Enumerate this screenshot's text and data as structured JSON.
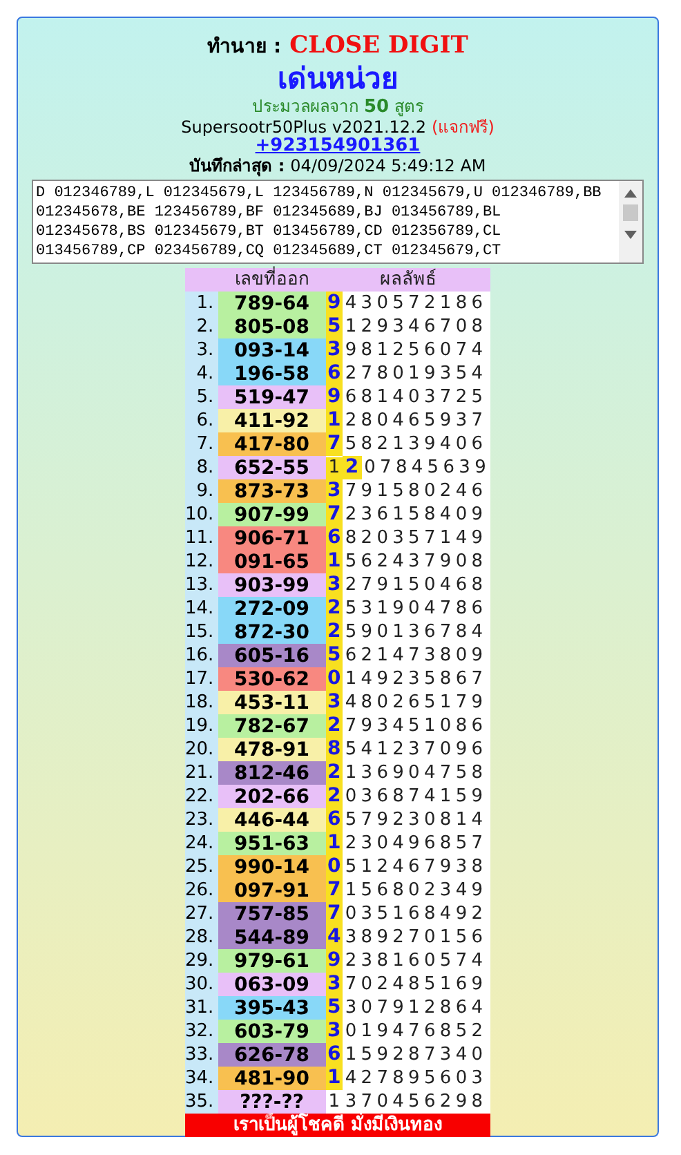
{
  "header": {
    "label": "ทำนาย :",
    "value": "CLOSE DIGIT"
  },
  "title": "เด่นหน่วย",
  "formula_note": "ประมวลผลจาก **50** สูตร",
  "version": {
    "name": "Supersootr50Plus v2021.12.2",
    "tag": "(แจกฟรี)"
  },
  "phone": "+923154901361",
  "last_saved": {
    "label": "บันทึกล่าสุด :",
    "value": "04/09/2024 5:49:12 AM"
  },
  "formula_text": "D 012346789,L 012345679,L 123456789,N 012345679,U 012346789,BB 012345678,BE 123456789,BF 012345689,BJ 013456789,BL 012345678,BS 012345679,BT 013456789,CD 012356789,CL 013456789,CP 023456789,CQ 012345689,CT 012345679,CT",
  "table": {
    "columns": [
      "เลขที่ออก",
      "ผลลัพธ์"
    ],
    "rows": [
      {
        "no": "1.",
        "code": "789-64",
        "color": "#b8f0a0",
        "strip": true,
        "result": [
          {
            "text": "9",
            "hit": true
          },
          {
            "text": "430572186",
            "hit": false
          }
        ]
      },
      {
        "no": "2.",
        "code": "805-08",
        "color": "#b8f0a0",
        "strip": true,
        "result": [
          {
            "text": "5",
            "hit": true
          },
          {
            "text": "129346708",
            "hit": false
          }
        ]
      },
      {
        "no": "3.",
        "code": "093-14",
        "color": "#88d8f8",
        "strip": true,
        "result": [
          {
            "text": "3",
            "hit": true
          },
          {
            "text": "981256074",
            "hit": false
          }
        ]
      },
      {
        "no": "4.",
        "code": "196-58",
        "color": "#88d8f8",
        "strip": true,
        "result": [
          {
            "text": "6",
            "hit": true
          },
          {
            "text": "278019354",
            "hit": false
          }
        ]
      },
      {
        "no": "5.",
        "code": "519-47",
        "color": "#e8c0f8",
        "strip": true,
        "result": [
          {
            "text": "9",
            "hit": true
          },
          {
            "text": "681403725",
            "hit": false
          }
        ]
      },
      {
        "no": "6.",
        "code": "411-92",
        "color": "#f8f0a8",
        "strip": true,
        "result": [
          {
            "text": "1",
            "hit": true
          },
          {
            "text": "280465937",
            "hit": false
          }
        ]
      },
      {
        "no": "7.",
        "code": "417-80",
        "color": "#f8c050",
        "strip": true,
        "result": [
          {
            "text": "7",
            "hit": true
          },
          {
            "text": "582139406",
            "hit": false
          }
        ]
      },
      {
        "no": "8.",
        "code": "652-55",
        "color": "#e8c0f8",
        "strip": true,
        "result": [
          {
            "text": "1",
            "hit": false
          },
          {
            "text": "2",
            "hit": true
          },
          {
            "text": "07845639",
            "hit": false
          }
        ]
      },
      {
        "no": "9.",
        "code": "873-73",
        "color": "#f8c050",
        "strip": true,
        "result": [
          {
            "text": "3",
            "hit": true
          },
          {
            "text": "791580246",
            "hit": false
          }
        ]
      },
      {
        "no": "10.",
        "code": "907-99",
        "color": "#b8f0a0",
        "strip": true,
        "result": [
          {
            "text": "7",
            "hit": true
          },
          {
            "text": "236158409",
            "hit": false
          }
        ]
      },
      {
        "no": "11.",
        "code": "906-71",
        "color": "#f88880",
        "strip": true,
        "result": [
          {
            "text": "6",
            "hit": true
          },
          {
            "text": "820357149",
            "hit": false
          }
        ]
      },
      {
        "no": "12.",
        "code": "091-65",
        "color": "#f88880",
        "strip": true,
        "result": [
          {
            "text": "1",
            "hit": true
          },
          {
            "text": "562437908",
            "hit": false
          }
        ]
      },
      {
        "no": "13.",
        "code": "903-99",
        "color": "#e8c0f8",
        "strip": true,
        "result": [
          {
            "text": "3",
            "hit": true
          },
          {
            "text": "279150468",
            "hit": false
          }
        ]
      },
      {
        "no": "14.",
        "code": "272-09",
        "color": "#88d8f8",
        "strip": true,
        "result": [
          {
            "text": "2",
            "hit": true
          },
          {
            "text": "531904786",
            "hit": false
          }
        ]
      },
      {
        "no": "15.",
        "code": "872-30",
        "color": "#88d8f8",
        "strip": true,
        "result": [
          {
            "text": "2",
            "hit": true
          },
          {
            "text": "590136784",
            "hit": false
          }
        ]
      },
      {
        "no": "16.",
        "code": "605-16",
        "color": "#a888c8",
        "strip": true,
        "result": [
          {
            "text": "5",
            "hit": true
          },
          {
            "text": "621473809",
            "hit": false
          }
        ]
      },
      {
        "no": "17.",
        "code": "530-62",
        "color": "#f88880",
        "strip": true,
        "result": [
          {
            "text": "0",
            "hit": true
          },
          {
            "text": "149235867",
            "hit": false
          }
        ]
      },
      {
        "no": "18.",
        "code": "453-11",
        "color": "#f8f0a8",
        "strip": true,
        "result": [
          {
            "text": "3",
            "hit": true
          },
          {
            "text": "480265179",
            "hit": false
          }
        ]
      },
      {
        "no": "19.",
        "code": "782-67",
        "color": "#b8f0a0",
        "strip": true,
        "result": [
          {
            "text": "2",
            "hit": true
          },
          {
            "text": "793451086",
            "hit": false
          }
        ]
      },
      {
        "no": "20.",
        "code": "478-91",
        "color": "#f8f0a8",
        "strip": true,
        "result": [
          {
            "text": "8",
            "hit": true
          },
          {
            "text": "541237096",
            "hit": false
          }
        ]
      },
      {
        "no": "21.",
        "code": "812-46",
        "color": "#a888c8",
        "strip": true,
        "result": [
          {
            "text": "2",
            "hit": true
          },
          {
            "text": "136904758",
            "hit": false
          }
        ]
      },
      {
        "no": "22.",
        "code": "202-66",
        "color": "#e8c0f8",
        "strip": true,
        "result": [
          {
            "text": "2",
            "hit": true
          },
          {
            "text": "036874159",
            "hit": false
          }
        ]
      },
      {
        "no": "23.",
        "code": "446-44",
        "color": "#f8f0a8",
        "strip": true,
        "result": [
          {
            "text": "6",
            "hit": true
          },
          {
            "text": "579230814",
            "hit": false
          }
        ]
      },
      {
        "no": "24.",
        "code": "951-63",
        "color": "#b8f0a0",
        "strip": true,
        "result": [
          {
            "text": "1",
            "hit": true
          },
          {
            "text": "230496857",
            "hit": false
          }
        ]
      },
      {
        "no": "25.",
        "code": "990-14",
        "color": "#f8c050",
        "strip": true,
        "result": [
          {
            "text": "0",
            "hit": true
          },
          {
            "text": "512467938",
            "hit": false
          }
        ]
      },
      {
        "no": "26.",
        "code": "097-91",
        "color": "#f8c050",
        "strip": true,
        "result": [
          {
            "text": "7",
            "hit": true
          },
          {
            "text": "156802349",
            "hit": false
          }
        ]
      },
      {
        "no": "27.",
        "code": "757-85",
        "color": "#a888c8",
        "strip": true,
        "result": [
          {
            "text": "7",
            "hit": true
          },
          {
            "text": "035168492",
            "hit": false
          }
        ]
      },
      {
        "no": "28.",
        "code": "544-89",
        "color": "#a888c8",
        "strip": true,
        "result": [
          {
            "text": "4",
            "hit": true
          },
          {
            "text": "389270156",
            "hit": false
          }
        ]
      },
      {
        "no": "29.",
        "code": "979-61",
        "color": "#b8f0a0",
        "strip": true,
        "result": [
          {
            "text": "9",
            "hit": true
          },
          {
            "text": "238160574",
            "hit": false
          }
        ]
      },
      {
        "no": "30.",
        "code": "063-09",
        "color": "#e8c0f8",
        "strip": true,
        "result": [
          {
            "text": "3",
            "hit": true
          },
          {
            "text": "702485169",
            "hit": false
          }
        ]
      },
      {
        "no": "31.",
        "code": "395-43",
        "color": "#88d8f8",
        "strip": true,
        "result": [
          {
            "text": "5",
            "hit": true
          },
          {
            "text": "307912864",
            "hit": false
          }
        ]
      },
      {
        "no": "32.",
        "code": "603-79",
        "color": "#b8f0a0",
        "strip": true,
        "result": [
          {
            "text": "3",
            "hit": true
          },
          {
            "text": "019476852",
            "hit": false
          }
        ]
      },
      {
        "no": "33.",
        "code": "626-78",
        "color": "#a888c8",
        "strip": true,
        "result": [
          {
            "text": "6",
            "hit": true
          },
          {
            "text": "159287340",
            "hit": false
          }
        ]
      },
      {
        "no": "34.",
        "code": "481-90",
        "color": "#f8c050",
        "strip": true,
        "result": [
          {
            "text": "1",
            "hit": true
          },
          {
            "text": "427895603",
            "hit": false
          }
        ]
      },
      {
        "no": "35.",
        "code": "???-??",
        "color": "#e8c0f8",
        "strip": false,
        "result": [
          {
            "text": "1",
            "hit": false
          },
          {
            "text": "370456298",
            "hit": false
          }
        ]
      }
    ],
    "footer": "เราเป็นผู้โชคดี มั่งมีเงินทอง"
  }
}
